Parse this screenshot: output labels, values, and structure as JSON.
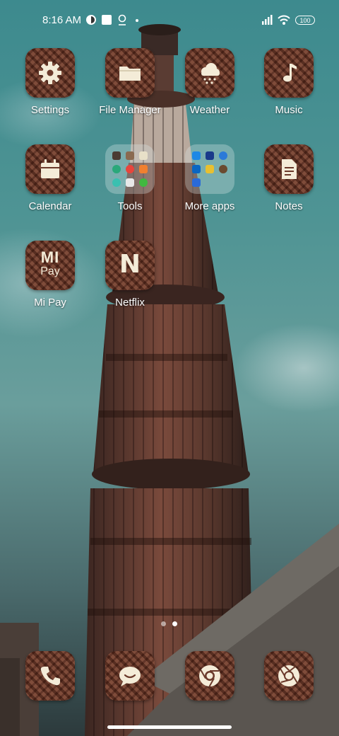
{
  "status_bar": {
    "time": "8:16 AM",
    "battery": "100",
    "icons": [
      "app-notification-icon",
      "square-icon",
      "location-pin-icon",
      "dot-icon",
      "signal-icon",
      "wifi-icon",
      "battery-icon"
    ]
  },
  "apps": [
    {
      "label": "Settings",
      "icon": "gear-icon"
    },
    {
      "label": "File Manager",
      "icon": "folder-icon"
    },
    {
      "label": "Weather",
      "icon": "cloud-rain-icon"
    },
    {
      "label": "Music",
      "icon": "music-note-icon"
    },
    {
      "label": "Calendar",
      "icon": "calendar-icon"
    },
    {
      "label": "Tools",
      "icon": "folder-grid-icon"
    },
    {
      "label": "More apps",
      "icon": "folder-grid-icon"
    },
    {
      "label": "Notes",
      "icon": "note-icon"
    },
    {
      "label": "Mi Pay",
      "icon": "mi-pay-icon",
      "glyph_top": "MI",
      "glyph_bottom": "Pay"
    },
    {
      "label": "Netflix",
      "icon": "netflix-icon",
      "glyph": "N"
    }
  ],
  "dock": [
    {
      "icon": "phone-icon"
    },
    {
      "icon": "message-icon"
    },
    {
      "icon": "chrome-icon"
    },
    {
      "icon": "camera-aperture-icon"
    }
  ],
  "pages": {
    "count": 2,
    "current": 2
  },
  "colors": {
    "icon_glyph": "#f4ecd8",
    "tile_brown": "#6b3a2b"
  }
}
